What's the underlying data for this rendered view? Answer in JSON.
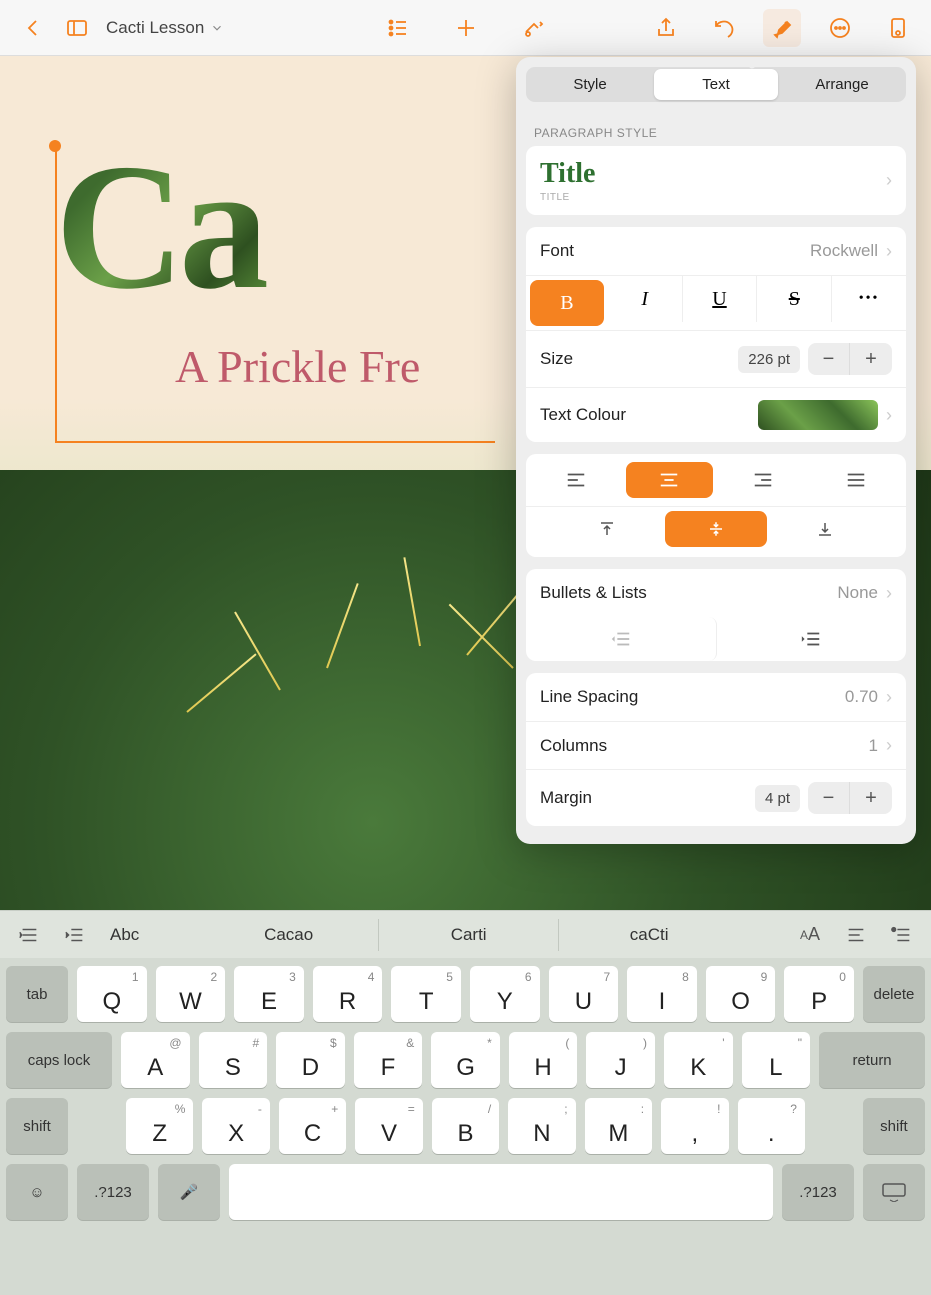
{
  "toolbar": {
    "document_title": "Cacti Lesson"
  },
  "canvas": {
    "title_text": "Ca",
    "subtitle_text": "A Prickle Fre"
  },
  "format_panel": {
    "tabs": {
      "style": "Style",
      "text": "Text",
      "arrange": "Arrange"
    },
    "paragraph_style_label": "PARAGRAPH STYLE",
    "paragraph_style": {
      "preview": "Title",
      "name": "TITLE"
    },
    "font": {
      "label": "Font",
      "value": "Rockwell"
    },
    "style_buttons": {
      "bold": "B",
      "italic": "I",
      "underline": "U",
      "strike": "S",
      "more": "•••"
    },
    "size": {
      "label": "Size",
      "value": "226 pt"
    },
    "text_colour": {
      "label": "Text Colour"
    },
    "bullets": {
      "label": "Bullets & Lists",
      "value": "None"
    },
    "line_spacing": {
      "label": "Line Spacing",
      "value": "0.70"
    },
    "columns": {
      "label": "Columns",
      "value": "1"
    },
    "margin": {
      "label": "Margin",
      "value": "4 pt"
    }
  },
  "shortcut_bar": {
    "abc": "Abc",
    "predictions": [
      "Cacao",
      "Carti",
      "caCti"
    ]
  },
  "keyboard": {
    "row1": [
      {
        "main": "Q",
        "alt": "1"
      },
      {
        "main": "W",
        "alt": "2"
      },
      {
        "main": "E",
        "alt": "3"
      },
      {
        "main": "R",
        "alt": "4"
      },
      {
        "main": "T",
        "alt": "5"
      },
      {
        "main": "Y",
        "alt": "6"
      },
      {
        "main": "U",
        "alt": "7"
      },
      {
        "main": "I",
        "alt": "8"
      },
      {
        "main": "O",
        "alt": "9"
      },
      {
        "main": "P",
        "alt": "0"
      }
    ],
    "row2": [
      {
        "main": "A",
        "alt": "@"
      },
      {
        "main": "S",
        "alt": "#"
      },
      {
        "main": "D",
        "alt": "$"
      },
      {
        "main": "F",
        "alt": "&"
      },
      {
        "main": "G",
        "alt": "*"
      },
      {
        "main": "H",
        "alt": "("
      },
      {
        "main": "J",
        "alt": ")"
      },
      {
        "main": "K",
        "alt": "'"
      },
      {
        "main": "L",
        "alt": "\""
      }
    ],
    "row3": [
      {
        "main": "Z",
        "alt": "%"
      },
      {
        "main": "X",
        "alt": "-"
      },
      {
        "main": "C",
        "alt": "+"
      },
      {
        "main": "V",
        "alt": "="
      },
      {
        "main": "B",
        "alt": "/"
      },
      {
        "main": "N",
        "alt": ";"
      },
      {
        "main": "M",
        "alt": ":"
      },
      {
        "main": ",",
        "alt": "!"
      },
      {
        "main": ".",
        "alt": "?"
      }
    ],
    "fn": {
      "tab": "tab",
      "delete": "delete",
      "caps": "caps lock",
      "return": "return",
      "shift": "shift",
      "numsym": ".?123"
    }
  }
}
